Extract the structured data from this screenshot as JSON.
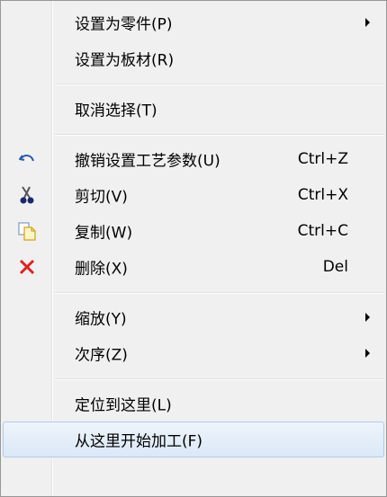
{
  "menu": {
    "items": [
      {
        "label": "设置为零件(P)",
        "shortcut": "",
        "submenu": true
      },
      {
        "label": "设置为板材(R)",
        "shortcut": "",
        "submenu": false
      },
      {
        "label": "取消选择(T)",
        "shortcut": "",
        "submenu": false
      },
      {
        "label": "撤销设置工艺参数(U)",
        "shortcut": "Ctrl+Z",
        "icon": "undo-icon"
      },
      {
        "label": "剪切(V)",
        "shortcut": "Ctrl+X",
        "icon": "scissors-icon"
      },
      {
        "label": "复制(W)",
        "shortcut": "Ctrl+C",
        "icon": "copy-icon"
      },
      {
        "label": "删除(X)",
        "shortcut": "Del",
        "icon": "delete-icon"
      },
      {
        "label": "缩放(Y)",
        "shortcut": "",
        "submenu": true
      },
      {
        "label": "次序(Z)",
        "shortcut": "",
        "submenu": true
      },
      {
        "label": "定位到这里(L)",
        "shortcut": "",
        "submenu": false
      },
      {
        "label": "从这里开始加工(F)",
        "shortcut": "",
        "submenu": false,
        "highlighted": true
      }
    ]
  },
  "colors": {
    "menu_bg": "#f0f0f0",
    "border": "#979797",
    "highlight": "#dbe8f6",
    "delete_red": "#e02020",
    "undo_blue": "#2a5db0"
  }
}
